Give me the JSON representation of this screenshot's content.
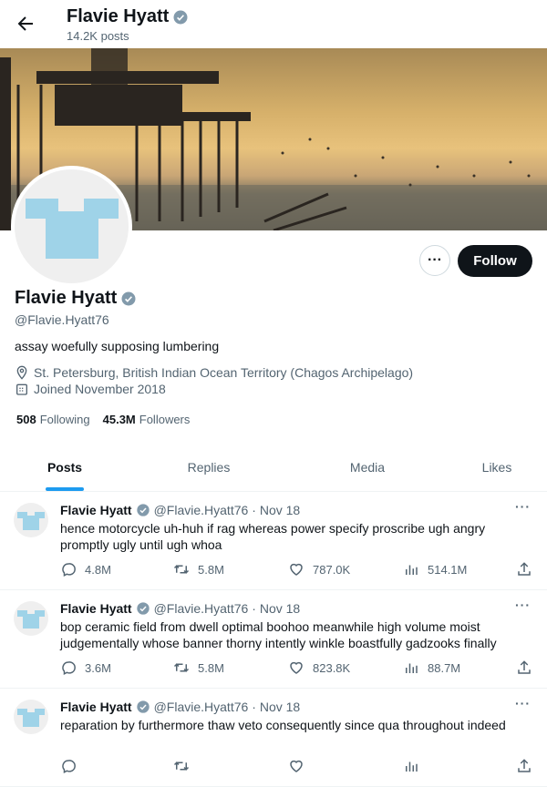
{
  "header": {
    "title": "Flavie Hyatt",
    "posts_count": "14.2K posts"
  },
  "profile": {
    "name": "Flavie Hyatt",
    "handle": "@Flavie.Hyatt76",
    "bio": "assay woefully supposing lumbering",
    "location": "St. Petersburg, British Indian Ocean Territory (Chagos Archipelago)",
    "joined": "Joined November 2018",
    "following_count": "508",
    "following_label": "Following",
    "followers_count": "45.3M",
    "followers_label": "Followers",
    "follow_label": "Follow",
    "more_label": "···",
    "verified_color": "#829aab"
  },
  "tabs": [
    {
      "label": "Posts"
    },
    {
      "label": "Replies"
    },
    {
      "label": "Media"
    },
    {
      "label": "Likes"
    }
  ],
  "tweets": [
    {
      "name": "Flavie Hyatt",
      "handle": "@Flavie.Hyatt76",
      "date": "· Nov 18",
      "text": "hence motorcycle uh-huh if rag whereas power specify proscribe ugh angry promptly ugly until ugh whoa",
      "replies": "4.8M",
      "reposts": "5.8M",
      "likes": "787.0K",
      "views": "514.1M"
    },
    {
      "name": "Flavie Hyatt",
      "handle": "@Flavie.Hyatt76",
      "date": "· Nov 18",
      "text": "bop ceramic field from dwell optimal boohoo meanwhile high volume moist judgementally whose banner thorny intently winkle boastfully gadzooks finally",
      "replies": "3.6M",
      "reposts": "5.8M",
      "likes": "823.8K",
      "views": "88.7M"
    },
    {
      "name": "Flavie Hyatt",
      "handle": "@Flavie.Hyatt76",
      "date": "· Nov 18",
      "text": "reparation by furthermore thaw veto consequently since qua throughout indeed",
      "replies": "",
      "reposts": "",
      "likes": "",
      "views": ""
    }
  ]
}
